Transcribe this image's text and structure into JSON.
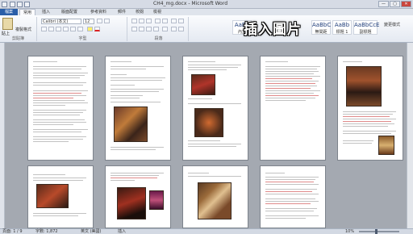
{
  "window": {
    "title": "CH4_mg.docx - Microsoft Word",
    "minimize": "—",
    "restore": "▢",
    "close": "✕"
  },
  "ribbon_tabs": [
    "檔案",
    "常用",
    "插入",
    "版面配置",
    "參考資料",
    "郵件",
    "校閱",
    "檢視"
  ],
  "active_tab_index": 1,
  "clipboard": {
    "paste_label": "貼上",
    "format_painter_label": "複製格式",
    "group_label": "剪貼簿"
  },
  "font": {
    "name": "Calibri (本文)",
    "size": "12",
    "group_label": "字型"
  },
  "paragraph": {
    "group_label": "段落"
  },
  "styles": {
    "items": [
      {
        "preview": "AaBb",
        "name": "內文"
      },
      {
        "preview": "AaBbC",
        "name": "無間距"
      },
      {
        "preview": "AaBb",
        "name": "標題 1"
      },
      {
        "preview": "AaBbCcE",
        "name": "副標題"
      }
    ],
    "change_styles_label": "變更樣式"
  },
  "overlay_caption": "插入圖片",
  "status": {
    "page": "頁面: 1 / 9",
    "words": "字數: 1,872",
    "language": "英文 (美國)",
    "mode": "插入",
    "zoom": "10%"
  },
  "colors": {
    "file_tab": "#2a5ea8",
    "workspace": "#a4a9b1",
    "red_text": "#e08a8a"
  }
}
